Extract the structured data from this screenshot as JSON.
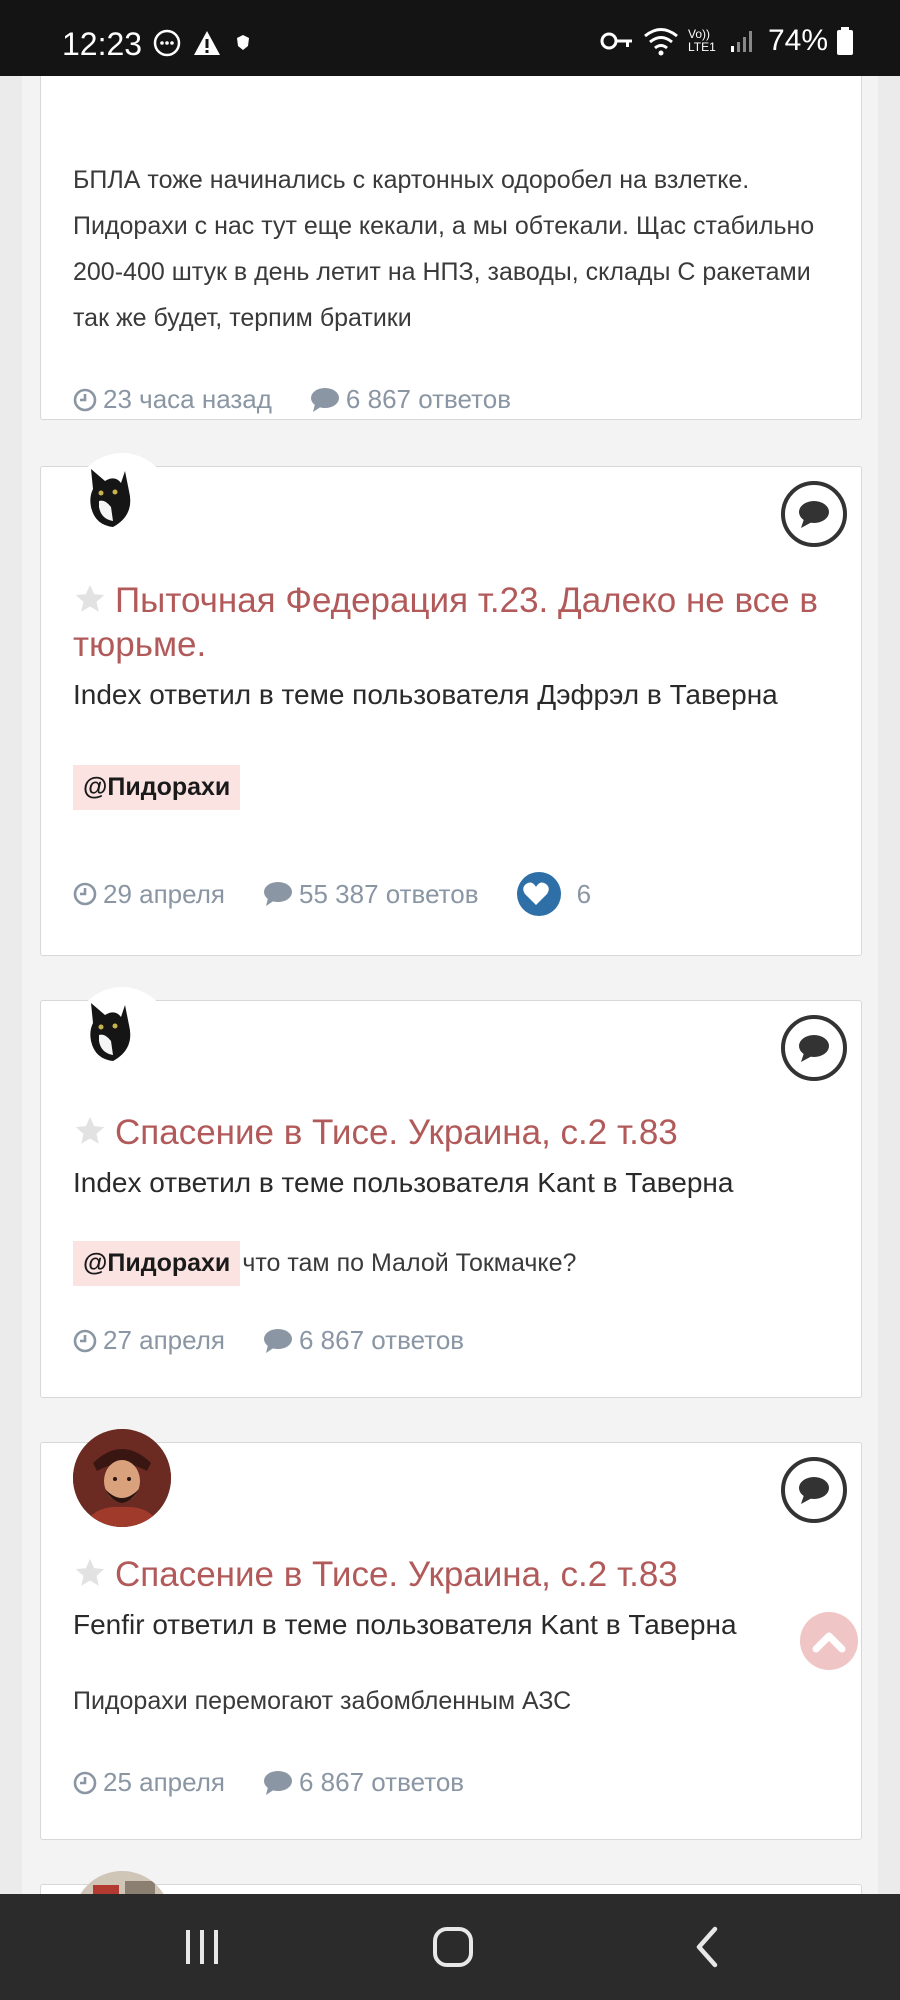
{
  "status_bar": {
    "time": "12:23",
    "battery": "74%",
    "network_label": "Vo)) LTE1",
    "icons": [
      "chat-bubble-icon",
      "warning-icon",
      "shield-icon",
      "key-icon",
      "wifi-icon",
      "signal-icon",
      "battery-icon"
    ]
  },
  "feed": {
    "posts": [
      {
        "excerpt": "БПЛА тоже начинались с картонных одоробел на взлетке. Пидорахи с нас тут еще кекали, а мы обтекали. Щас стабильно 200-400 штук в день летит на НПЗ, заводы, склады С ракетами так же будет, терпим братики",
        "time": "23 часа назад",
        "replies": "6 867 ответов"
      },
      {
        "title": "Пыточная Федерация т.23. Далеко не все в тюрьме.",
        "subtitle": "Index ответил в теме пользователя Дэфрэл в Таверна",
        "mention": "@Пидорахи",
        "snippet": "",
        "time": "29 апреля",
        "replies": "55 387 ответов",
        "likes": "6"
      },
      {
        "title": "Спасение в Тисе. Украина, с.2 т.83",
        "subtitle": "Index ответил в теме пользователя Kant в Таверна",
        "mention": "@Пидорахи",
        "snippet": "что там по Малой Токмачке?",
        "time": "27 апреля",
        "replies": "6 867 ответов"
      },
      {
        "title": "Спасение в Тисе. Украина, с.2 т.83",
        "subtitle": "Fenfir ответил в теме пользователя Kant в Таверна",
        "snippet": "Пидорахи перемогают забомбленным АЗС",
        "time": "25 апреля",
        "replies": "6 867 ответов"
      }
    ]
  },
  "colors": {
    "title": "#b25a5a",
    "meta": "#8a96a3",
    "mention_bg": "#fbe3e1",
    "like": "#2d6fa6"
  }
}
